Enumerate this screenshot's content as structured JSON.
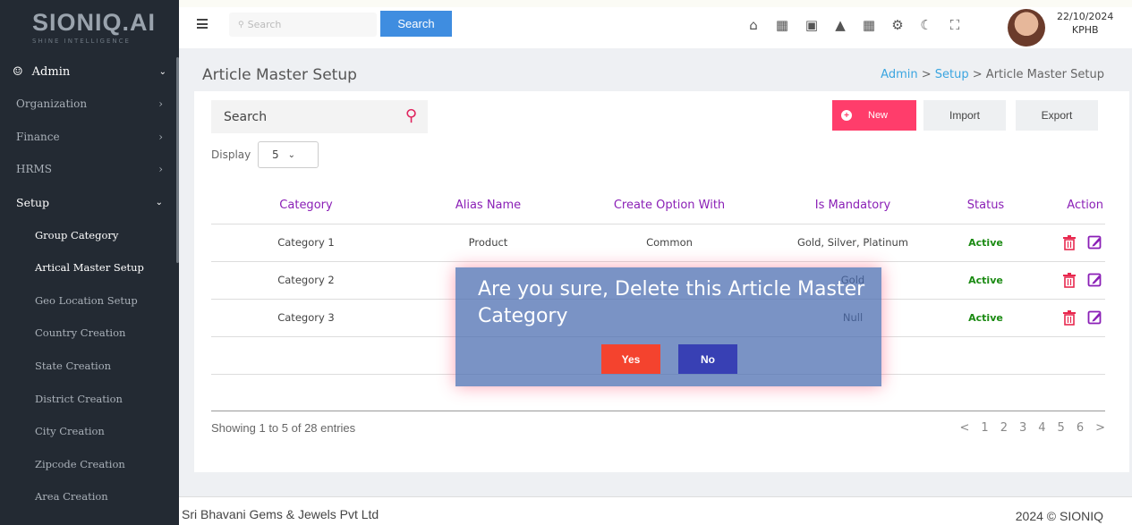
{
  "brand": {
    "logo": "SIONIQ.AI",
    "tagline": "SHINE INTELLIGENCE"
  },
  "sidebar": {
    "admin_label": "Admin",
    "menu": [
      {
        "label": "Organization"
      },
      {
        "label": "Finance"
      },
      {
        "label": "HRMS"
      }
    ],
    "open_label": "Setup",
    "subitems": [
      {
        "label": "Group Category"
      },
      {
        "label": "Artical Master Setup"
      },
      {
        "label": "Geo Location Setup"
      },
      {
        "label": "Country Creation"
      },
      {
        "label": "State Creation"
      },
      {
        "label": "District Creation"
      },
      {
        "label": "City Creation"
      },
      {
        "label": "Zipcode Creation"
      },
      {
        "label": "Area Creation"
      }
    ]
  },
  "topbar": {
    "search_placeholder": "Search",
    "search_button": "Search",
    "date": "22/10/2024",
    "location": "KPHB"
  },
  "page": {
    "title": "Article Master Setup",
    "breadcrumb": {
      "admin": "Admin",
      "sep1": " > ",
      "setup": "Setup",
      "sep2": " > ",
      "current": "Article Master Setup"
    }
  },
  "toolbar": {
    "search_label": "Search",
    "new_label": "New",
    "import_label": "Import",
    "export_label": "Export",
    "display_label": "Display",
    "display_value": "5"
  },
  "table": {
    "headers": [
      "Category",
      "Alias Name",
      "Create Option With",
      "Is Mandatory",
      "Status",
      "Action"
    ],
    "rows": [
      {
        "category": "Category 1",
        "alias": "Product",
        "option": "Common",
        "mandatory": "Gold, Silver, Platinum",
        "status": "Active"
      },
      {
        "category": "Category 2",
        "alias": "",
        "option": "",
        "mandatory": "Gold",
        "status": "Active"
      },
      {
        "category": "Category 3",
        "alias": "",
        "option": "",
        "mandatory": "Null",
        "status": "Active"
      }
    ]
  },
  "pagination": {
    "showing": "Showing 1 to 5 of 28 entries",
    "prev": "<",
    "pages": [
      "1",
      "2",
      "3",
      "4",
      "5",
      "6"
    ],
    "next": ">"
  },
  "footer": {
    "company": "Sri Bhavani Gems & Jewels Pvt Ltd",
    "copyright": "2024 © SIONIQ"
  },
  "modal": {
    "message": "Are you sure, Delete this Article Master Category",
    "yes_label": "Yes",
    "no_label": "No"
  },
  "colors": {
    "accent_pink": "#ff3d6b",
    "accent_purple": "#8a1fb6",
    "status_green": "#1a8a12",
    "sidebar_bg": "#232a33"
  }
}
